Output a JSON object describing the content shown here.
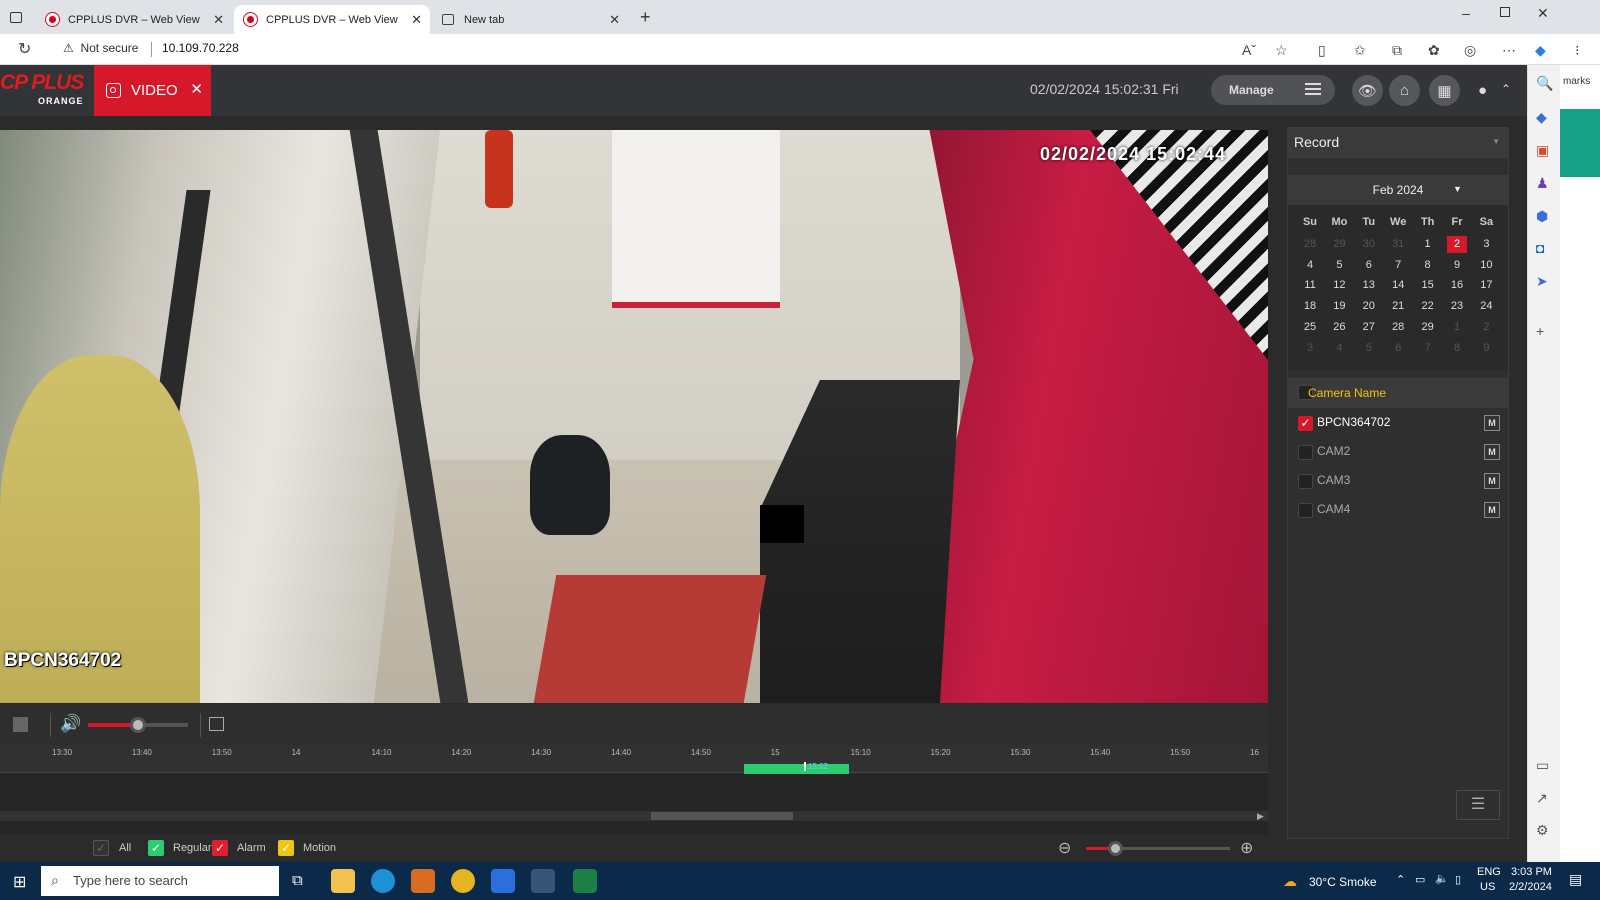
{
  "browser": {
    "tabs": [
      {
        "label": "CPPLUS DVR – Web View",
        "active": false
      },
      {
        "label": "CPPLUS DVR – Web View",
        "active": true
      },
      {
        "label": "New tab",
        "active": false
      }
    ],
    "security_label": "Not secure",
    "url": "10.109.70.228",
    "side_text": "marks"
  },
  "app": {
    "logo_text": "CP PLUS",
    "logo_sub": "ORANGE",
    "video_tab_label": "VIDEO",
    "datetime": "02/02/2024 15:02:31 Fri",
    "manage_label": "Manage",
    "osd_time": "02/02/2024 15:02:44",
    "osd_camera": "BPCN364702",
    "volume_level": 0.5,
    "zoom_level": 0.2,
    "timeline_ticks": [
      "13:30",
      "13:40",
      "13:50",
      "14",
      "14:10",
      "14:20",
      "14:30",
      "14:40",
      "14:50",
      "15",
      "15:10",
      "15:20",
      "15:30",
      "15:40",
      "15:50",
      "16"
    ],
    "timeline_cursor_label": "15:02",
    "record_fraction": {
      "start": 0.571,
      "end": 0.659
    },
    "legend": {
      "all": "All",
      "regular": "Regular",
      "alarm": "Alarm",
      "motion": "Motion"
    },
    "colors": {
      "accent": "#d7182a",
      "regular": "#2ecc71",
      "motion": "#f1c40f"
    }
  },
  "panel": {
    "record_select": "Record",
    "calendar": {
      "month": "Feb 2024",
      "dow": [
        "Su",
        "Mo",
        "Tu",
        "We",
        "Th",
        "Fr",
        "Sa"
      ],
      "weeks": [
        [
          [
            "28",
            0
          ],
          [
            "29",
            0
          ],
          [
            "30",
            0
          ],
          [
            "31",
            0
          ],
          [
            "1",
            1
          ],
          [
            "2",
            2
          ],
          [
            "3",
            1
          ]
        ],
        [
          [
            "4",
            1
          ],
          [
            "5",
            1
          ],
          [
            "6",
            1
          ],
          [
            "7",
            1
          ],
          [
            "8",
            1
          ],
          [
            "9",
            1
          ],
          [
            "10",
            1
          ]
        ],
        [
          [
            "11",
            1
          ],
          [
            "12",
            1
          ],
          [
            "13",
            1
          ],
          [
            "14",
            1
          ],
          [
            "15",
            1
          ],
          [
            "16",
            1
          ],
          [
            "17",
            1
          ]
        ],
        [
          [
            "18",
            1
          ],
          [
            "19",
            1
          ],
          [
            "20",
            1
          ],
          [
            "21",
            1
          ],
          [
            "22",
            1
          ],
          [
            "23",
            1
          ],
          [
            "24",
            1
          ]
        ],
        [
          [
            "25",
            1
          ],
          [
            "26",
            1
          ],
          [
            "27",
            1
          ],
          [
            "28",
            1
          ],
          [
            "29",
            1
          ],
          [
            "1",
            0
          ],
          [
            "2",
            0
          ]
        ],
        [
          [
            "3",
            0
          ],
          [
            "4",
            0
          ],
          [
            "5",
            0
          ],
          [
            "6",
            0
          ],
          [
            "7",
            0
          ],
          [
            "8",
            0
          ],
          [
            "9",
            0
          ]
        ]
      ]
    },
    "camera_header": "Camera Name",
    "cameras": [
      {
        "name": "BPCN364702",
        "checked": true,
        "m": "M"
      },
      {
        "name": "CAM2",
        "checked": false,
        "m": "M"
      },
      {
        "name": "CAM3",
        "checked": false,
        "m": "M"
      },
      {
        "name": "CAM4",
        "checked": false,
        "m": "M"
      }
    ]
  },
  "taskbar": {
    "search_placeholder": "Type here to search",
    "weather": "30°C  Smoke",
    "lang": "ENG",
    "region": "US",
    "time": "3:03 PM",
    "date": "2/2/2024"
  }
}
